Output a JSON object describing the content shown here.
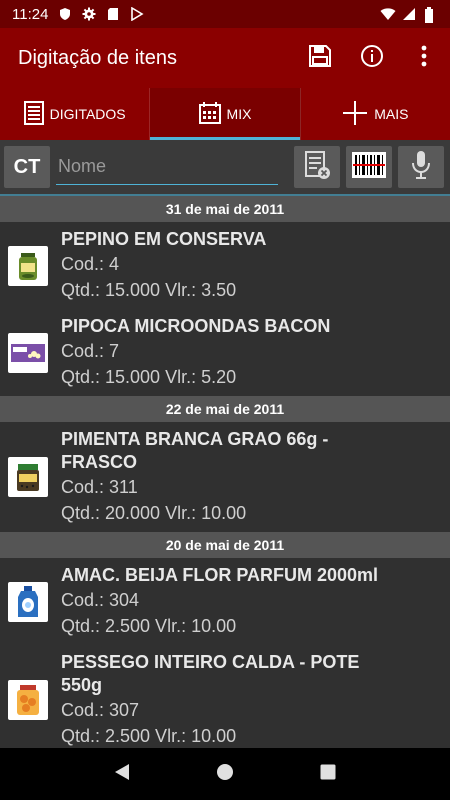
{
  "status_bar": {
    "time": "11:24",
    "icons_left": [
      "shield-icon",
      "gear-icon",
      "sd-card-icon",
      "play-store-icon"
    ],
    "icons_right": [
      "wifi-icon",
      "signal-icon",
      "battery-icon"
    ]
  },
  "app_bar": {
    "title": "Digitação de itens",
    "actions": [
      "save-icon",
      "info-icon",
      "overflow-menu-icon"
    ]
  },
  "tabs": [
    {
      "label": "DIGITADOS",
      "icon": "list-doc-icon",
      "active": false
    },
    {
      "label": "MIX",
      "icon": "calendar-grid-icon",
      "active": true
    },
    {
      "label": "MAIS",
      "icon": "plus-icon",
      "active": false
    }
  ],
  "search": {
    "ct_label": "CT",
    "placeholder": "Nome",
    "value": "",
    "buttons": [
      "clear-list-icon",
      "barcode-icon",
      "microphone-icon"
    ]
  },
  "groups": [
    {
      "date": "31 de mai de 2011",
      "items": [
        {
          "name": "PEPINO EM CONSERVA",
          "cod": "Cod.: 4",
          "qtd": "Qtd.: 15.000 Vlr.: 3.50",
          "thumb": "pickle-jar-icon",
          "thumb_color": "#6a8c2a"
        },
        {
          "name": "PIPOCA MICROONDAS BACON",
          "cod": "Cod.: 7",
          "qtd": "Qtd.: 15.000 Vlr.: 5.20",
          "thumb": "popcorn-box-icon",
          "thumb_color": "#7b4fa8"
        }
      ]
    },
    {
      "date": "22 de mai de 2011",
      "items": [
        {
          "name": "PIMENTA BRANCA GRAO 66g - FRASCO",
          "cod": "Cod.: 311",
          "qtd": "Qtd.: 20.000 Vlr.: 10.00",
          "thumb": "pepper-jar-icon",
          "thumb_color": "#4a6a2a"
        }
      ]
    },
    {
      "date": "20 de mai de 2011",
      "items": [
        {
          "name": "AMAC. BEIJA FLOR PARFUM 2000ml",
          "cod": "Cod.: 304",
          "qtd": "Qtd.: 2.500 Vlr.: 10.00",
          "thumb": "softener-bottle-icon",
          "thumb_color": "#2a6fc0"
        },
        {
          "name": "PESSEGO INTEIRO CALDA - POTE 550g",
          "cod": "Cod.: 307",
          "qtd": "Qtd.: 2.500 Vlr.: 10.00",
          "thumb": "peach-jar-icon",
          "thumb_color": "#e8901a"
        }
      ]
    }
  ],
  "nav": [
    "back-icon",
    "home-icon",
    "recents-icon"
  ]
}
